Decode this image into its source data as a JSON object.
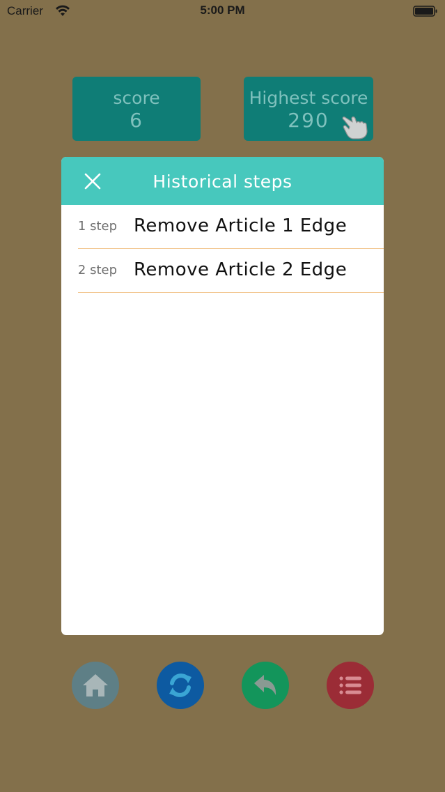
{
  "status_bar": {
    "carrier": "Carrier",
    "time": "5:00 PM"
  },
  "score": {
    "label": "score",
    "value": "6"
  },
  "highest_score": {
    "label": "Highest score",
    "value": "290"
  },
  "modal": {
    "title": "Historical steps",
    "steps": [
      {
        "number": "1 step",
        "text": "Remove Article 1 Edge"
      },
      {
        "number": "2 step",
        "text": "Remove Article 2 Edge"
      }
    ]
  },
  "toolbar": {
    "buttons": [
      "home-icon",
      "refresh-icon",
      "undo-icon",
      "list-icon"
    ],
    "colors": {
      "home": "#5e7f86",
      "refresh": "#0d5aa1",
      "undo": "#13955b",
      "list": "#9b2c36"
    }
  },
  "colors": {
    "background": "#83704b",
    "score_box": "#0f7d76",
    "modal_header": "#47c8bd",
    "divider": "#f2c690"
  }
}
